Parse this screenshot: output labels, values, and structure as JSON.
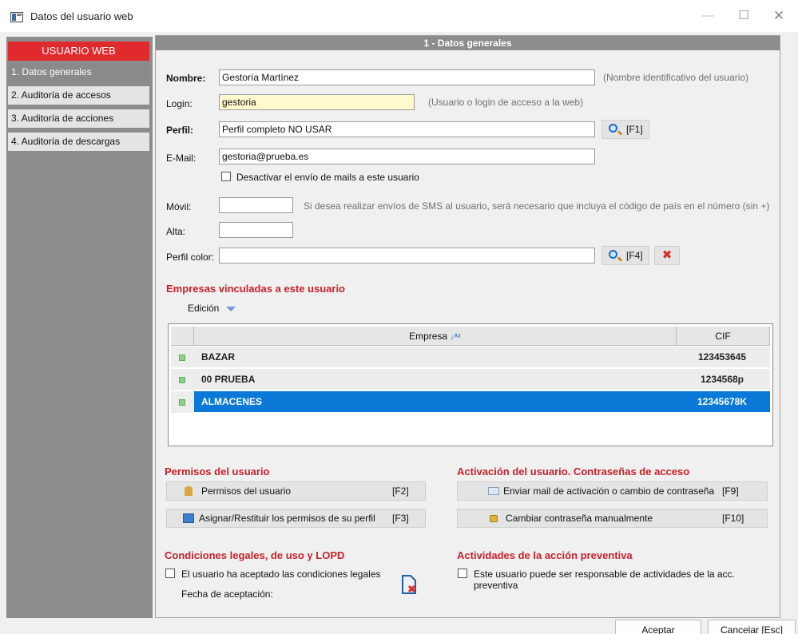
{
  "window": {
    "title": "Datos del usuario web"
  },
  "sidebar": {
    "header": "USUARIO WEB",
    "items": [
      {
        "label": "1. Datos generales",
        "active": true
      },
      {
        "label": "2. Auditoría de accesos",
        "active": false
      },
      {
        "label": "3. Auditoría de acciones",
        "active": false
      },
      {
        "label": "4. Auditoría de descargas",
        "active": false
      }
    ]
  },
  "section": {
    "title": "1 - Datos generales"
  },
  "form": {
    "nombre": {
      "label": "Nombre:",
      "value": "Gestoría Martínez",
      "hint": "(Nombre identificativo del usuario)"
    },
    "login": {
      "label": "Login:",
      "value": "gestoria",
      "hint": "(Usuario o login de acceso a la web)"
    },
    "perfil": {
      "label": "Perfil:",
      "value": "Perfil completo NO USAR",
      "button": "[F1]"
    },
    "email": {
      "label": "E-Mail:",
      "value": "gestoria@prueba.es"
    },
    "desactivar_mails": {
      "label": "Desactivar el envío de mails a este usuario",
      "checked": false
    },
    "movil": {
      "label": "Móvil:",
      "value": "",
      "hint": "Si desea realizar envíos de SMS al usuario, será necesario que incluya el código de país en el número (sin +)"
    },
    "alta": {
      "label": "Alta:",
      "value": ""
    },
    "perfil_color": {
      "label": "Perfil color:",
      "value": "",
      "button": "[F4]"
    }
  },
  "empresas": {
    "title": "Empresas vinculadas a este usuario",
    "edicion": "Edición",
    "columns": [
      "Empresa",
      "CIF"
    ],
    "rows": [
      {
        "empresa": "BAZAR",
        "cif": "123453645",
        "selected": false
      },
      {
        "empresa": "00 PRUEBA",
        "cif": "1234568p",
        "selected": false
      },
      {
        "empresa": "ALMACENES",
        "cif": "12345678K",
        "selected": true
      }
    ]
  },
  "permisos": {
    "title": "Permisos del usuario",
    "btn_permisos": {
      "label": "Permisos del usuario",
      "key": "[F2]"
    },
    "btn_asignar": {
      "label": "Asignar/Restituir los permisos de su perfil",
      "key": "[F3]"
    }
  },
  "activacion": {
    "title": "Activación del usuario. Contraseñas de acceso",
    "btn_mail": {
      "label": "Enviar mail de activación o cambio de contraseña",
      "key": "[F9]"
    },
    "btn_cambiar": {
      "label": "Cambiar contraseña manualmente",
      "key": "[F10]"
    }
  },
  "legal": {
    "title": "Condiciones legales, de uso y LOPD",
    "acepto_label": "El usuario ha aceptado las condiciones legales",
    "fecha_label": "Fecha de aceptación:"
  },
  "preventiva": {
    "title": "Actividades de la acción preventiva",
    "label": "Este usuario puede ser responsable de actividades de la acc. preventiva"
  },
  "footer": {
    "aceptar": "Aceptar",
    "cancelar": "Cancelar [Esc]"
  },
  "colors": {
    "accent_red": "#e02a2e",
    "title_red": "#c8202a",
    "selection_blue": "#0a78d7",
    "sidebar_gray": "#8c8c8c"
  }
}
